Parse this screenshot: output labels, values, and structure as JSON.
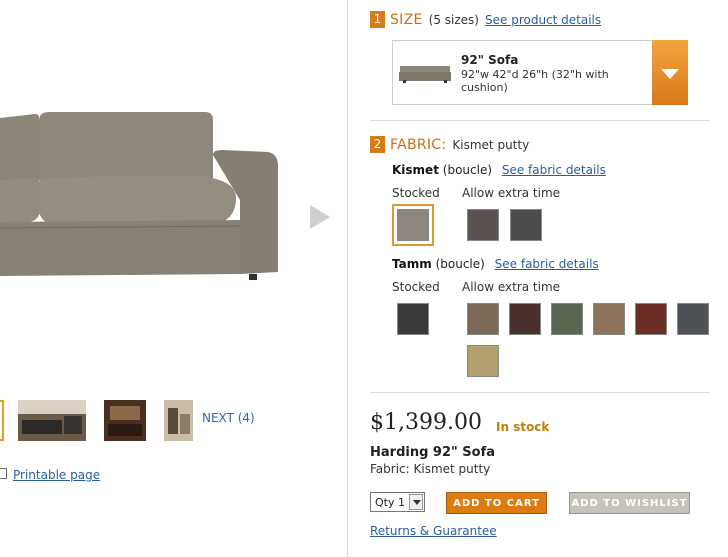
{
  "gallery": {
    "next_label": "NEXT (4)",
    "printable_label": "Printable page"
  },
  "size": {
    "step": "1",
    "title": "SIZE",
    "count": "(5 sizes)",
    "details_link": "See product details",
    "selected_name": "92\" Sofa",
    "selected_desc": "92\"w 42\"d 26\"h (32\"h with cushion)"
  },
  "fabric": {
    "step": "2",
    "title": "FABRIC:",
    "selected": "Kismet putty",
    "groups": [
      {
        "name": "Kismet",
        "type": "(boucle)",
        "link": "See fabric details",
        "stocked_label": "Stocked",
        "extra_label": "Allow extra time",
        "stocked": [
          "#8e8780"
        ],
        "extra": [
          "#5a5350",
          "#4c4a4c"
        ]
      },
      {
        "name": "Tamm",
        "type": "(boucle)",
        "link": "See fabric details",
        "stocked_label": "Stocked",
        "extra_label": "Allow extra time",
        "stocked": [
          "#3a3a3a"
        ],
        "extra": [
          "#7c6a58",
          "#4a302c",
          "#5a6650",
          "#8d7458",
          "#6a2e24",
          "#4e5256",
          "#b3a070"
        ]
      }
    ]
  },
  "purchase": {
    "price": "$1,399.00",
    "stock": "In stock",
    "product_name": "Harding 92\" Sofa",
    "product_fabric": "Fabric: Kismet putty",
    "qty_label": "Qty 1",
    "add_to_cart": "ADD TO CART",
    "add_to_wishlist": "ADD TO WISHLIST",
    "returns_link": "Returns & Guarantee"
  },
  "colors": {
    "accent_orange": "#d77a18",
    "link_blue": "#2a5d9f",
    "sofa_fabric": "#8a8479"
  }
}
